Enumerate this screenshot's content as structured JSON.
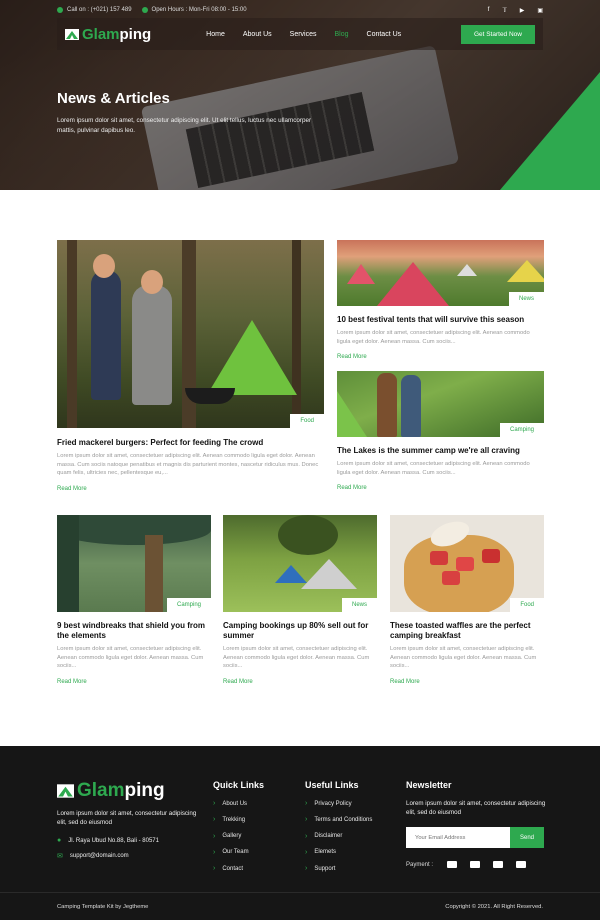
{
  "topbar": {
    "phone": "Call on : (+021) 157 489",
    "hours": "Open Hours : Mon-Fri 08:00 - 15:00",
    "socials": [
      "facebook-icon",
      "twitter-icon",
      "youtube-icon",
      "instagram-icon"
    ]
  },
  "nav": {
    "logo_a": "Glam",
    "logo_b": "ping",
    "items": [
      "Home",
      "About Us",
      "Services",
      "Blog",
      "Contact Us"
    ],
    "active": "Blog",
    "cta": "Get Started Now"
  },
  "hero": {
    "title": "News & Articles",
    "subtitle": "Lorem ipsum dolor sit amet, consectetur adipiscing elit. Ut elit tellus, luctus nec ullamcorper mattis, pulvinar dapibus leo."
  },
  "posts": {
    "big": {
      "tag": "Food",
      "title": "Fried mackerel burgers: Perfect for feeding The crowd",
      "text": "Lorem ipsum dolor sit amet, consectetuer adipiscing elit. Aenean commodo ligula eget dolor. Aenean massa. Cum sociis natoque penatibus et magnis dis parturient montes, nascetur ridiculus mus. Donec quam felis, ultricies nec, pellentesque eu,...",
      "more": "Read More"
    },
    "side1": {
      "tag": "News",
      "title": "10 best festival tents that will survive this season",
      "text": "Lorem ipsum dolor sit amet, consectetuer adipiscing elit. Aenean commodo ligula eget dolor. Aenean massa. Cum sociis...",
      "more": "Read More"
    },
    "side2": {
      "tag": "Camping",
      "title": "The Lakes is the summer camp we're all craving",
      "text": "Lorem ipsum dolor sit amet, consectetuer adipiscing elit. Aenean commodo ligula eget dolor. Aenean massa. Cum sociis...",
      "more": "Read More"
    },
    "row": [
      {
        "tag": "Camping",
        "title": "9 best windbreaks that shield you from the elements",
        "text": "Lorem ipsum dolor sit amet, consectetuer adipiscing elit. Aenean commodo ligula eget dolor. Aenean massa. Cum sociis...",
        "more": "Read More"
      },
      {
        "tag": "News",
        "title": "Camping bookings up 80% sell out for summer",
        "text": "Lorem ipsum dolor sit amet, consectetuer adipiscing elit. Aenean commodo ligula eget dolor. Aenean massa. Cum sociis...",
        "more": "Read More"
      },
      {
        "tag": "Food",
        "title": "These toasted waffles are the perfect camping breakfast",
        "text": "Lorem ipsum dolor sit amet, consectetuer adipiscing elit. Aenean commodo ligula eget dolor. Aenean massa. Cum sociis...",
        "more": "Read More"
      }
    ]
  },
  "footer": {
    "logo_a": "Glam",
    "logo_b": "ping",
    "desc": "Lorem ipsum dolor sit amet, consectetur adipiscing elit, sed do eiusmod",
    "address": "Jl. Raya Ubud No.88, Bali - 80571",
    "email": "support@domain.com",
    "quick_title": "Quick Links",
    "quick": [
      "About Us",
      "Trekking",
      "Gallery",
      "Our Team",
      "Contact"
    ],
    "useful_title": "Useful Links",
    "useful": [
      "Privacy Policy",
      "Terms and Conditions",
      "Disclaimer",
      "Elemets",
      "Support"
    ],
    "newsletter_title": "Newsletter",
    "newsletter_desc": "Lorem ipsum dolor sit amet, consectetur adipiscing elit, sed do eiusmod",
    "email_placeholder": "Your Email Address",
    "send": "Send",
    "payment": "Payment :",
    "credit": "Camping Template Kit by Jegtheme",
    "copyright": "Copyright © 2021. All Right Reserved."
  },
  "colors": {
    "accent": "#2ea94f",
    "footer_bg": "#161616"
  }
}
